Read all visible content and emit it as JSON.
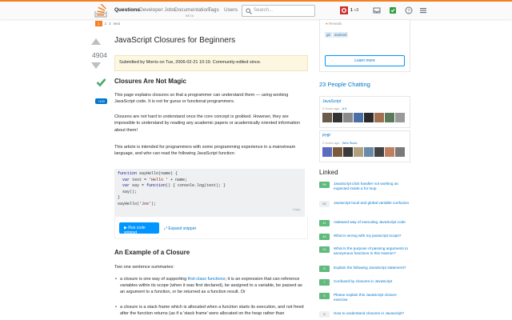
{
  "header": {
    "nav": [
      "Questions",
      "Developer Jobs",
      "Documentation",
      "Tags",
      "Users"
    ],
    "beta_label": "BETA",
    "search_placeholder": "Search...",
    "reputation": "1",
    "badges": "3"
  },
  "pager": {
    "current": "1",
    "pages": [
      "2",
      "3"
    ],
    "next": "next"
  },
  "question": {
    "score": "4904",
    "bounty": "+100",
    "title": "JavaScript Closures for Beginners",
    "notice": "Submitted by Morris on Tue, 2006-02-21 10:19. Community-edited since.",
    "heading1": "Closures Are Not Magic",
    "p1": "This page explains closures so that a programmer can understand them — using working JavaScript code. It is not for gurus or functional programmers.",
    "p2": "Closures are not hard to understand once the core concept is grokked. However, they are impossible to understand by reading any academic papers or academically oriented information about them!",
    "p3": "This article is intended for programmers with some programming experience in a mainstream language, and who can read the following JavaScript function:",
    "copy_label": "Copy",
    "run_button": "Run code snippet",
    "expand_link": "Expand snippet",
    "heading2": "An Example of a Closure",
    "p4": "Two one sentence summaries:",
    "b1_pre": "a closure is one way of supporting ",
    "b1_link": "first-class functions",
    "b1_post": "; it is an expression that can reference variables within its scope (when it was first declared), be assigned to a variable, be passed as an argument to a function, or be returned as a function result. Or",
    "b2": "a closure is a stack frame which is allocated when a function starts its execution, and not freed after the function returns (as if a 'stack frame' were allocated on the heap rather than"
  },
  "code": {
    "l1a": "function",
    "l1b": " sayHello(name) {",
    "l2a": "  var",
    "l2b": " text = ",
    "l2c": "'Hello '",
    "l2d": " + name;",
    "l3a": "  var",
    "l3b": " say = ",
    "l3c": "function",
    "l3d": "() { console.log(text); }",
    "l4": "  say();",
    "l5": "}",
    "l6a": "sayHello(",
    "l6b": "'Joe'",
    "l6c": ");"
  },
  "sidebar": {
    "reveal": "Reveals",
    "tags": [
      "git",
      "android"
    ],
    "learn_more": "Learn more",
    "chat_title": "23 People Chatting",
    "rooms": [
      {
        "name": "JavaScript",
        "time": "2 hours ago - ",
        "user": "A K"
      },
      {
        "name": "PHP",
        "time": "2 hours ago - ",
        "user": "Wes Slack"
      }
    ],
    "linked_title": "Linked",
    "linked": [
      {
        "count": "99",
        "q": "JavaScript click handler not working as expected inside a for loop",
        "accepted": true
      },
      {
        "count": "52",
        "q": "Javascript local and global variable confusion",
        "accepted": false
      },
      {
        "count": "41",
        "q": "Awkward way of executing JavaScript code",
        "accepted": true
      },
      {
        "count": "40",
        "q": "What is wrong with my javascript scope?",
        "accepted": true
      },
      {
        "count": "24",
        "q": "What is the purpose of passing arguments to anonymous functions in this manner?",
        "accepted": true
      },
      {
        "count": "8",
        "q": "Explain the following JavaScript statement?",
        "accepted": true
      },
      {
        "count": "7",
        "q": "Confused by closures in JavaScript",
        "accepted": true
      },
      {
        "count": "5",
        "q": "Please explain this JavaScript closure exercise",
        "accepted": true
      },
      {
        "count": "6",
        "q": "How to understand closures in Javascript?",
        "accepted": false
      }
    ]
  }
}
